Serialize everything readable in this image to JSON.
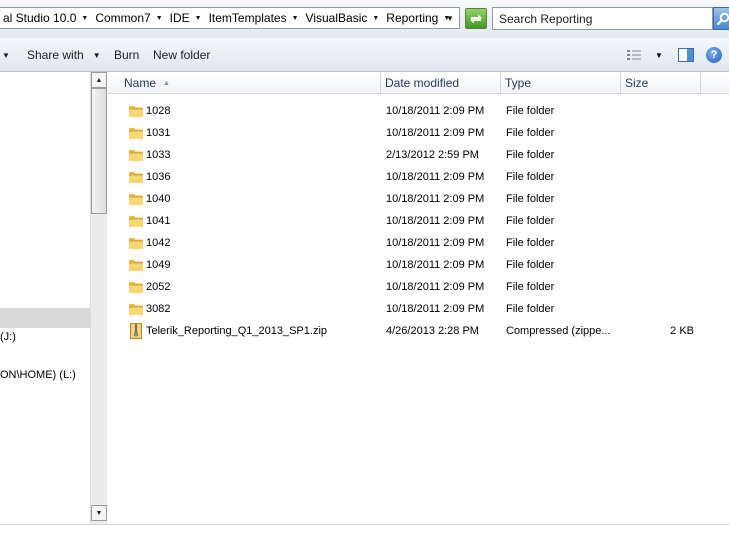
{
  "address_bar": {
    "crumbs": [
      "al Studio 10.0",
      "Common7",
      "IDE",
      "ItemTemplates",
      "VisualBasic",
      "Reporting"
    ]
  },
  "search": {
    "placeholder": "Search Reporting"
  },
  "toolbar": {
    "share_with_label": "Share with",
    "burn_label": "Burn",
    "new_folder_label": "New folder",
    "help_label": "?"
  },
  "nav_pane": {
    "drive_j_label": "(J:)",
    "drive_l_label": "ON\\HOME) (L:)"
  },
  "columns": {
    "name": "Name",
    "date_modified": "Date modified",
    "type": "Type",
    "size": "Size"
  },
  "files": [
    {
      "name": "1028",
      "date": "10/18/2011 2:09 PM",
      "type": "File folder",
      "size": "",
      "icon": "folder-icon"
    },
    {
      "name": "1031",
      "date": "10/18/2011 2:09 PM",
      "type": "File folder",
      "size": "",
      "icon": "folder-icon"
    },
    {
      "name": "1033",
      "date": "2/13/2012 2:59 PM",
      "type": "File folder",
      "size": "",
      "icon": "folder-icon"
    },
    {
      "name": "1036",
      "date": "10/18/2011 2:09 PM",
      "type": "File folder",
      "size": "",
      "icon": "folder-icon"
    },
    {
      "name": "1040",
      "date": "10/18/2011 2:09 PM",
      "type": "File folder",
      "size": "",
      "icon": "folder-icon"
    },
    {
      "name": "1041",
      "date": "10/18/2011 2:09 PM",
      "type": "File folder",
      "size": "",
      "icon": "folder-icon"
    },
    {
      "name": "1042",
      "date": "10/18/2011 2:09 PM",
      "type": "File folder",
      "size": "",
      "icon": "folder-icon"
    },
    {
      "name": "1049",
      "date": "10/18/2011 2:09 PM",
      "type": "File folder",
      "size": "",
      "icon": "folder-icon"
    },
    {
      "name": "2052",
      "date": "10/18/2011 2:09 PM",
      "type": "File folder",
      "size": "",
      "icon": "folder-icon"
    },
    {
      "name": "3082",
      "date": "10/18/2011 2:09 PM",
      "type": "File folder",
      "size": "",
      "icon": "folder-icon"
    },
    {
      "name": "Telerik_Reporting_Q1_2013_SP1.zip",
      "date": "4/26/2013 2:28 PM",
      "type": "Compressed (zippe...",
      "size": "2 KB",
      "icon": "zip-file-icon"
    }
  ]
}
